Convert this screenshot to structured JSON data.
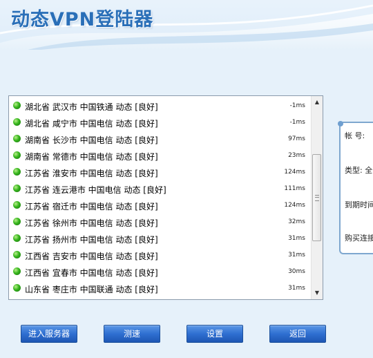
{
  "app": {
    "title": "动态VPN登陆器"
  },
  "servers": [
    {
      "name": "湖北省  武汉市  中国铁通  动态 [良好]",
      "latency": "-1ms"
    },
    {
      "name": "湖北省  咸宁市  中国电信  动态 [良好]",
      "latency": "-1ms"
    },
    {
      "name": "湖南省  长沙市  中国电信  动态 [良好]",
      "latency": "97ms"
    },
    {
      "name": "湖南省  常德市  中国电信  动态 [良好]",
      "latency": "23ms"
    },
    {
      "name": "江苏省  淮安市  中国电信  动态 [良好]",
      "latency": "124ms"
    },
    {
      "name": "江苏省  连云港市  中国电信  动态 [良好]",
      "latency": "111ms"
    },
    {
      "name": "江苏省  宿迁市  中国电信  动态 [良好]",
      "latency": "124ms"
    },
    {
      "name": "江苏省  徐州市  中国电信  动态 [良好]",
      "latency": "32ms"
    },
    {
      "name": "江苏省  扬州市  中国电信  动态 [良好]",
      "latency": "31ms"
    },
    {
      "name": "江西省  吉安市  中国电信  动态 [良好]",
      "latency": "31ms"
    },
    {
      "name": "江西省  宜春市  中国电信  动态 [良好]",
      "latency": "30ms"
    },
    {
      "name": "山东省  枣庄市  中国联通  动态 [良好]",
      "latency": "31ms"
    }
  ],
  "status_color": "#35b51c",
  "scrollbar": {
    "up_icon": "arrow-up-icon",
    "down_icon": "arrow-down-icon"
  },
  "info": {
    "account_label": "帐 号:",
    "type_label": "类型: 全",
    "expiry_label": "到期时间",
    "purchase_label": "购买连接"
  },
  "buttons": {
    "enter": "进入服务器",
    "speedtest": "测速",
    "settings": "设置",
    "back": "返回"
  }
}
